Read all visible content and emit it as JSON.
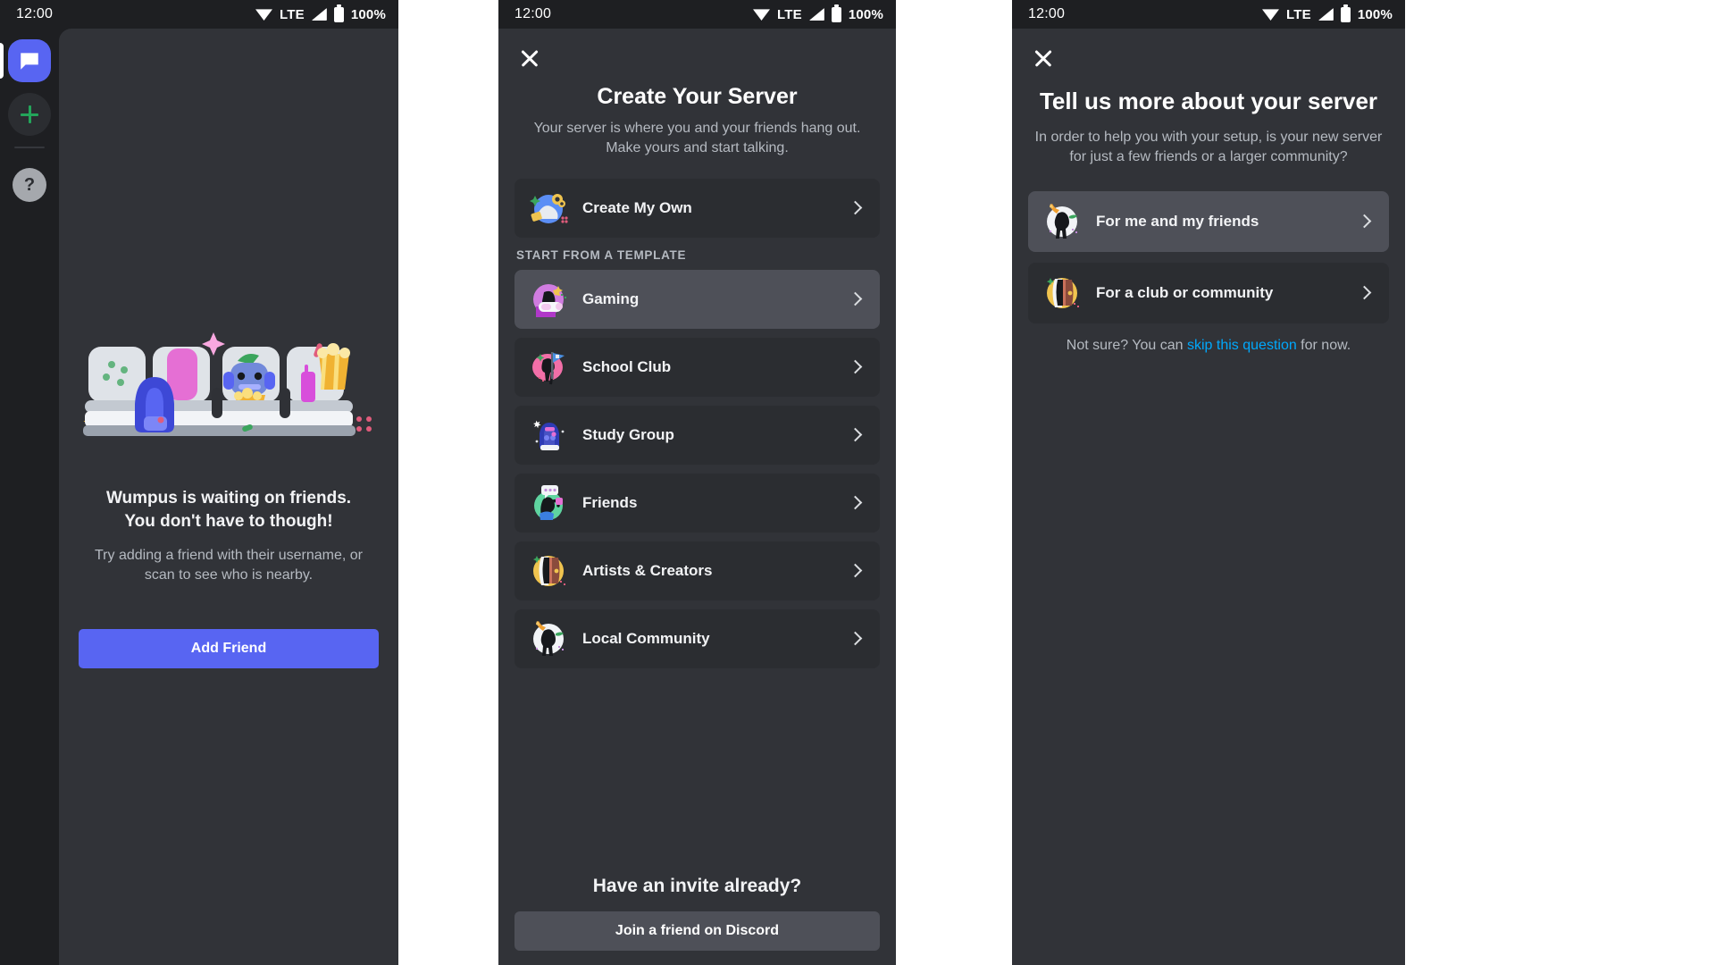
{
  "status_bar": {
    "time": "12:00",
    "network": "LTE",
    "battery": "100%"
  },
  "panel_friends": {
    "guild_bar": {
      "home_icon": "discord-messages-icon",
      "add_server_icon": "plus-icon",
      "help_icon": "question-mark-icon"
    },
    "illustration": "wumpus-waiting-theater-seats",
    "title": "Wumpus is waiting on friends. You don't have to though!",
    "subtitle": "Try adding a friend with their username, or scan to see who is nearby.",
    "add_friend_label": "Add Friend",
    "accent_color": "#5865f2"
  },
  "panel_create_server": {
    "close_label": "close-icon",
    "title": "Create Your Server",
    "description": "Your server is where you and your friends hang out. Make yours and start talking.",
    "create_own": {
      "label": "Create My Own",
      "icon": "planet-sparkle-icon"
    },
    "section_label": "START FROM A TEMPLATE",
    "templates": [
      {
        "label": "Gaming",
        "icon": "gaming-headset-icon",
        "active": true
      },
      {
        "label": "School Club",
        "icon": "school-flag-icon",
        "active": false
      },
      {
        "label": "Study Group",
        "icon": "backpack-icon",
        "active": false
      },
      {
        "label": "Friends",
        "icon": "friends-chat-icon",
        "active": false
      },
      {
        "label": "Artists & Creators",
        "icon": "artist-easel-icon",
        "active": false
      },
      {
        "label": "Local Community",
        "icon": "local-community-icon",
        "active": false
      }
    ],
    "invite_title": "Have an invite already?",
    "invite_button": "Join a friend on Discord"
  },
  "panel_server_size": {
    "close_label": "close-icon",
    "title": "Tell us more about your server",
    "description": "In order to help you with your setup, is your new server for just a few friends or a larger community?",
    "options": [
      {
        "label": "For me and my friends",
        "icon": "local-community-icon",
        "active": true
      },
      {
        "label": "For a club or community",
        "icon": "artist-easel-icon",
        "active": false
      }
    ],
    "skip_prefix": "Not sure? You can ",
    "skip_link": "skip this question",
    "skip_suffix": " for now."
  }
}
